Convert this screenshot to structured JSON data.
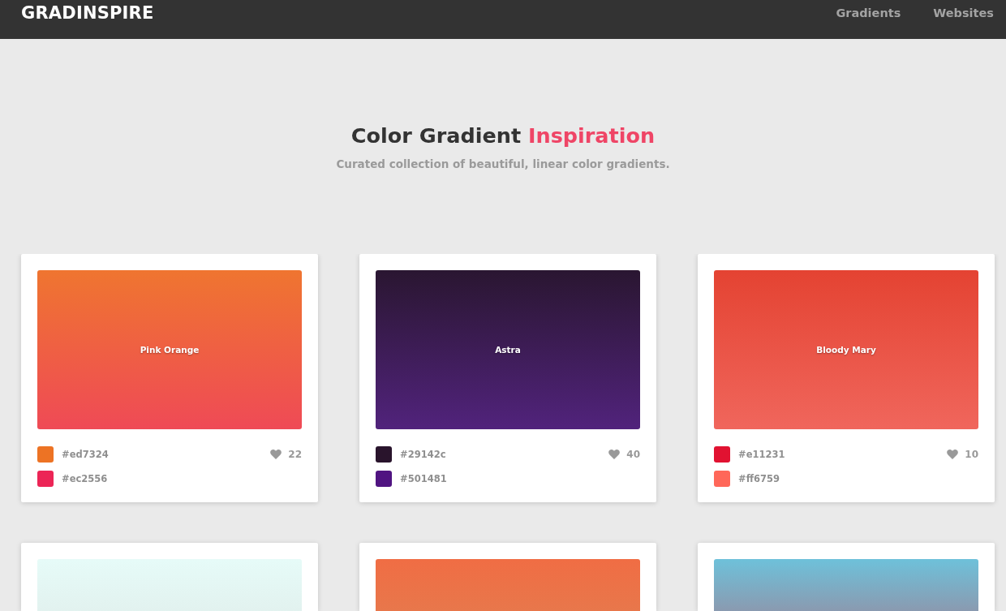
{
  "header": {
    "logo": "GRADINSPIRE",
    "nav": [
      {
        "label": "Gradients"
      },
      {
        "label": "Websites"
      }
    ]
  },
  "hero": {
    "title": "Color Gradient",
    "title_highlight": "Inspiration",
    "subtitle": "Curated collection of beautiful, linear color gradients."
  },
  "cards": [
    {
      "name": "Pink Orange",
      "gradient": [
        {
          "color": "#ef7530"
        },
        {
          "color": "#ef4a56"
        }
      ],
      "swatches": [
        {
          "hex": "#ed7324",
          "color": "#ed7324"
        },
        {
          "hex": "#ec2556",
          "color": "#ec2556"
        }
      ],
      "likes": "22"
    },
    {
      "name": "Astra",
      "gradient": [
        {
          "color": "#2a1631"
        },
        {
          "color": "#51237c"
        }
      ],
      "swatches": [
        {
          "hex": "#29142c",
          "color": "#29142c"
        },
        {
          "hex": "#501481",
          "color": "#501481"
        }
      ],
      "likes": "40"
    },
    {
      "name": "Bloody Mary",
      "gradient": [
        {
          "color": "#e44332"
        },
        {
          "color": "#f0665c"
        }
      ],
      "swatches": [
        {
          "hex": "#e11231",
          "color": "#e11231"
        },
        {
          "hex": "#ff6759",
          "color": "#ff6759"
        }
      ],
      "likes": "10"
    },
    {
      "gradient": [
        {
          "color": "#e6fbf8"
        },
        {
          "color": "#e2f2ef"
        }
      ]
    },
    {
      "gradient": [
        {
          "color": "#f06d44"
        },
        {
          "color": "#e8774b"
        }
      ]
    },
    {
      "gradient": [
        {
          "color": "#6ec1da"
        },
        {
          "color": "#8a9ab0"
        }
      ]
    }
  ]
}
